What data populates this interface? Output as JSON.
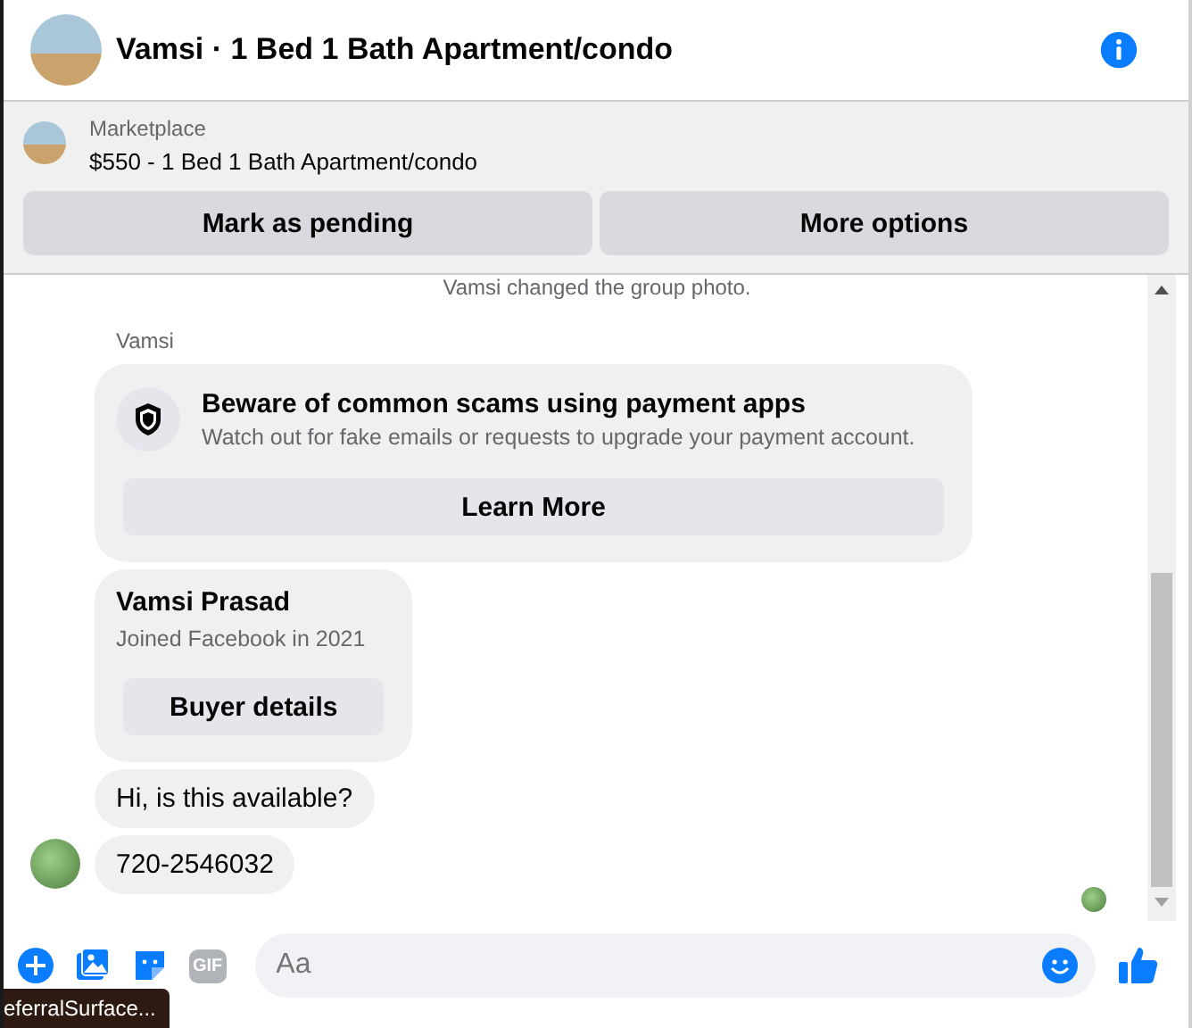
{
  "header": {
    "title": "Vamsi · 1 Bed 1 Bath Apartment/condo"
  },
  "listing": {
    "source": "Marketplace",
    "title": "$550 - 1 Bed 1 Bath Apartment/condo",
    "buttons": [
      "Mark as pending",
      "More options"
    ]
  },
  "messages": [
    {
      "kind": "event",
      "text": "Vamsi changed the group photo."
    },
    {
      "kind": "sender",
      "text": "Vamsi"
    },
    {
      "kind": "notice",
      "title": "Beware of common scams using payment apps",
      "text": "Watch out for fake emails or requests to upgrade your payment account.",
      "button": "Learn More"
    },
    {
      "kind": "profile",
      "name": "Vamsi Prasad",
      "text": "Joined Facebook in 2021",
      "button": "Buyer details"
    },
    {
      "kind": "text",
      "text": "Hi, is this available?"
    },
    {
      "kind": "text",
      "text": "720-2546032"
    }
  ],
  "composer": {
    "gif_label": "GIF",
    "placeholder": "Aa"
  },
  "tooltip": "eferralSurface..."
}
